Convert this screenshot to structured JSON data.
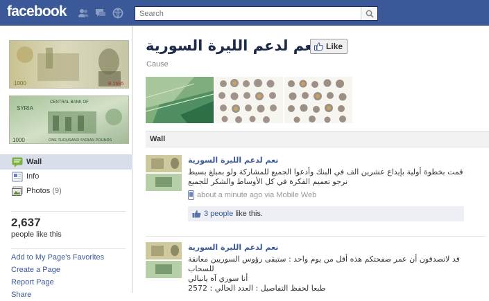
{
  "topbar": {
    "logo": "facebook",
    "search": {
      "placeholder": "Search",
      "value": ""
    },
    "icons": [
      "friends-icon",
      "messages-icon",
      "notifications-icon",
      "search-icon"
    ],
    "colors": {
      "bar": "#3b5998",
      "link": "#3b5998",
      "active_nav": "#d8dfea"
    }
  },
  "sidebar": {
    "nav": [
      {
        "label": "Wall",
        "icon": "wall-icon",
        "active": true
      },
      {
        "label": "Info",
        "icon": "info-icon"
      },
      {
        "label": "Photos",
        "count": "(9)",
        "icon": "photos-icon"
      }
    ],
    "likes": {
      "count": "2,637",
      "label": "people like this"
    },
    "links": [
      "Add to My Page's Favorites",
      "Create a Page",
      "Report Page",
      "Share"
    ]
  },
  "page": {
    "title": "نعم لدعم الليرة السورية",
    "like_button": "Like",
    "category": "Cause"
  },
  "wall": {
    "header": "Wall",
    "posts": [
      {
        "author": "نعم لدعم الليرة السورية",
        "lines": [
          "قمت بخطوة أولية بإيداع عشرين الف في البنك وأدعوا الجميع للمشاركة ولو بمبلغ بسيط",
          "نرجو تعميم الفكرة في كل الأوساط والشكر للجميع"
        ],
        "time": "about a minute ago via Mobile Web",
        "likes_link": "3 people",
        "likes_suffix": "like this."
      },
      {
        "author": "نعم لدعم الليرة السورية",
        "lines": [
          "قد لاتصدقون أن عمر صفحتكم هذه أقل من يوم واحد : ستبقى رؤوس السوريين معانقة",
          "للسحاب",
          "أنا سوري آه يانيالي",
          "طبعا لحفظ التفاصيل : العدد الحالي : 2572"
        ]
      }
    ]
  }
}
